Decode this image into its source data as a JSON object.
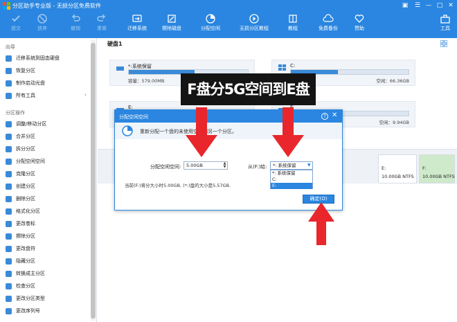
{
  "app": {
    "title": "分区助手专业版 - 无损分区免费软件"
  },
  "window_controls": {
    "icon1": "▣",
    "icon2": "☰",
    "minimize": "—",
    "maximize": "□",
    "close": "✕"
  },
  "toolbar": {
    "items": [
      {
        "label": "提交",
        "icon": "check-icon",
        "enabled": false
      },
      {
        "label": "放弃",
        "icon": "discard-icon",
        "enabled": false
      },
      {
        "label": "撤销",
        "icon": "undo-icon",
        "enabled": false
      },
      {
        "label": "重做",
        "icon": "redo-icon",
        "enabled": false
      },
      {
        "label": "迁移系统",
        "icon": "migrate-icon",
        "enabled": true
      },
      {
        "label": "擦除磁盘",
        "icon": "eraser-icon",
        "enabled": true
      },
      {
        "label": "分配空闲",
        "icon": "allocate-icon",
        "enabled": true
      },
      {
        "label": "无损分区教程",
        "icon": "play-icon",
        "enabled": true
      },
      {
        "label": "教程",
        "icon": "book-icon",
        "enabled": true
      },
      {
        "label": "免费备份",
        "icon": "backup-icon",
        "enabled": true
      },
      {
        "label": "赞助",
        "icon": "heart-icon",
        "enabled": true
      },
      {
        "label": "工具",
        "icon": "toolbox-icon",
        "enabled": true
      }
    ]
  },
  "sidebar": {
    "section1": "向导",
    "wizard_items": [
      "迁移系统到固态硬盘",
      "恢复分区",
      "制作启动光盘",
      "所有工具"
    ],
    "section2": "分区操作",
    "op_items": [
      "调整/移动分区",
      "合并分区",
      "拆分分区",
      "分配空闲空间",
      "克隆分区",
      "创建分区",
      "删除分区",
      "格式化分区",
      "更改卷标",
      "擦除分区",
      "更改盘符",
      "隐藏分区",
      "转换成主分区",
      "检查分区",
      "更改分区类型",
      "更改序列号"
    ]
  },
  "disk": {
    "label": "硬盘1"
  },
  "partitions": [
    {
      "name": "*:系统保留",
      "capacity": "容量：579.00MB",
      "free": "",
      "fill": 0.55
    },
    {
      "name": "C:",
      "capacity": "",
      "free": "空闲：66.36GB",
      "fill": 0.4
    },
    {
      "name": "E:",
      "capacity": "",
      "free": "",
      "fill": 0.0
    },
    {
      "name": "F:",
      "capacity": "",
      "free": "空闲：9.94GB",
      "fill": 0.02
    }
  ],
  "disk_map": [
    {
      "letter": "E:",
      "size": "10.00GB NTFS",
      "color": "#ffffff"
    },
    {
      "letter": "F:",
      "size": "10.00GB NTFS",
      "color": "#cfeacb"
    }
  ],
  "banner": "F盘分5G空间到E盘",
  "dialog": {
    "title": "分配空闲空间",
    "description": "重新分配一个盘的未使用空间到另一个分区。",
    "size_label": "分配空闲空间:",
    "size_value": "5.00GB",
    "from_label": "从(F:)给:",
    "from_value": "*: 系统保留",
    "options": [
      "*: 系统保留",
      "C:",
      "E:"
    ],
    "selected_option": 2,
    "info": "当前(F:)将分大小时5.00GB, (*:)盘的大小是5.57GB.",
    "ok_label": "确定(O)",
    "help": "?",
    "close": "✕"
  },
  "colors": {
    "brand": "#2a86e0",
    "arrow": "#e8262c",
    "banner_bg": "#141414"
  }
}
